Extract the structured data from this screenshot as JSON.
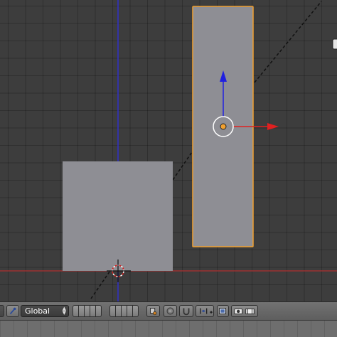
{
  "viewport": {
    "background": "#3d3d3d",
    "x_axis_color": "#b03030",
    "y_axis_color": "#3030c8",
    "mesh_fill": "#8e8e94",
    "selected_outline": "#f0a030",
    "manipulator_x_color": "#e02020",
    "manipulator_y_color": "#2020e0"
  },
  "toolbar": {
    "pivot_icon": "pivot-point-icon",
    "orientation_label": "Global",
    "layer_groups": 2,
    "tools": [
      "mesh-select-icon",
      "proportional-edit-icon",
      "snap-magnet-icon",
      "snap-element-icon",
      "render-icon",
      "camera-render-icon"
    ]
  }
}
